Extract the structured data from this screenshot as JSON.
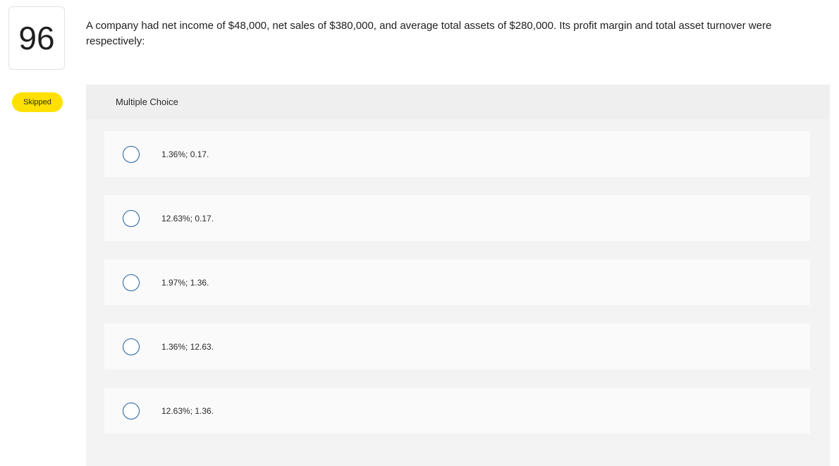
{
  "question": {
    "number": "96",
    "status": "Skipped",
    "text": "A company had net income of $48,000, net sales of $380,000, and average total assets of $280,000. Its profit margin and total asset turnover were respectively:"
  },
  "answer_panel": {
    "header": "Multiple Choice",
    "choices": [
      {
        "label": "1.36%; 0.17."
      },
      {
        "label": "12.63%; 0.17."
      },
      {
        "label": "1.97%; 1.36."
      },
      {
        "label": "1.36%; 12.63."
      },
      {
        "label": "12.63%; 1.36."
      }
    ]
  },
  "colors": {
    "badge": "#ffe000",
    "radio_border": "#1f5f9e",
    "panel_bg": "#f3f3f3"
  }
}
